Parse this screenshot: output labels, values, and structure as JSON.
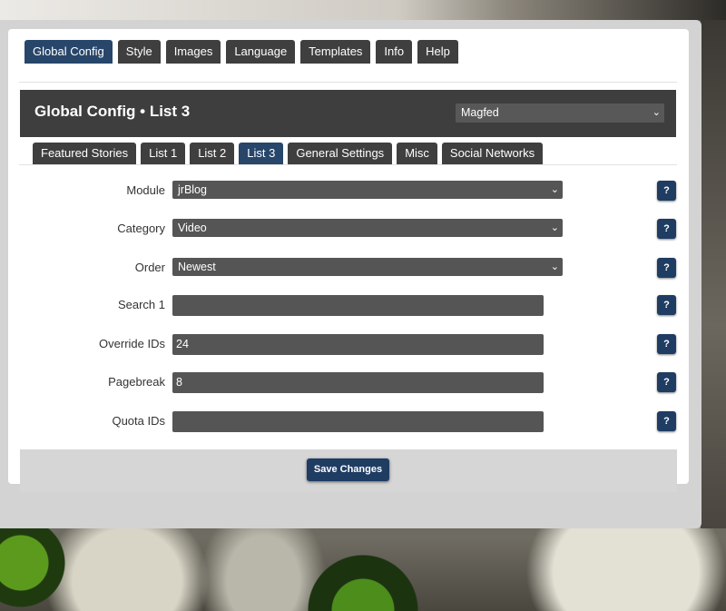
{
  "tabs": [
    "Global Config",
    "Style",
    "Images",
    "Language",
    "Templates",
    "Info",
    "Help"
  ],
  "header": {
    "title": "Global Config • List 3",
    "profile_select": "Magfed"
  },
  "subtabs": [
    "Featured Stories",
    "List 1",
    "List 2",
    "List 3",
    "General Settings",
    "Misc",
    "Social Networks"
  ],
  "form": {
    "module": {
      "label": "Module",
      "value": "jrBlog"
    },
    "category": {
      "label": "Category",
      "value": "Video"
    },
    "order": {
      "label": "Order",
      "value": "Newest"
    },
    "search1": {
      "label": "Search 1",
      "value": ""
    },
    "override_ids": {
      "label": "Override IDs",
      "value": "24"
    },
    "pagebreak": {
      "label": "Pagebreak",
      "value": "8"
    },
    "quota_ids": {
      "label": "Quota IDs",
      "value": ""
    }
  },
  "help_label": "?",
  "chevron": "⌄",
  "save_label": "Save Changes",
  "colors": {
    "active_tab": "#27466a",
    "tab": "#3f3f3f",
    "header": "#3e3e3e",
    "button": "#1f3c63"
  }
}
